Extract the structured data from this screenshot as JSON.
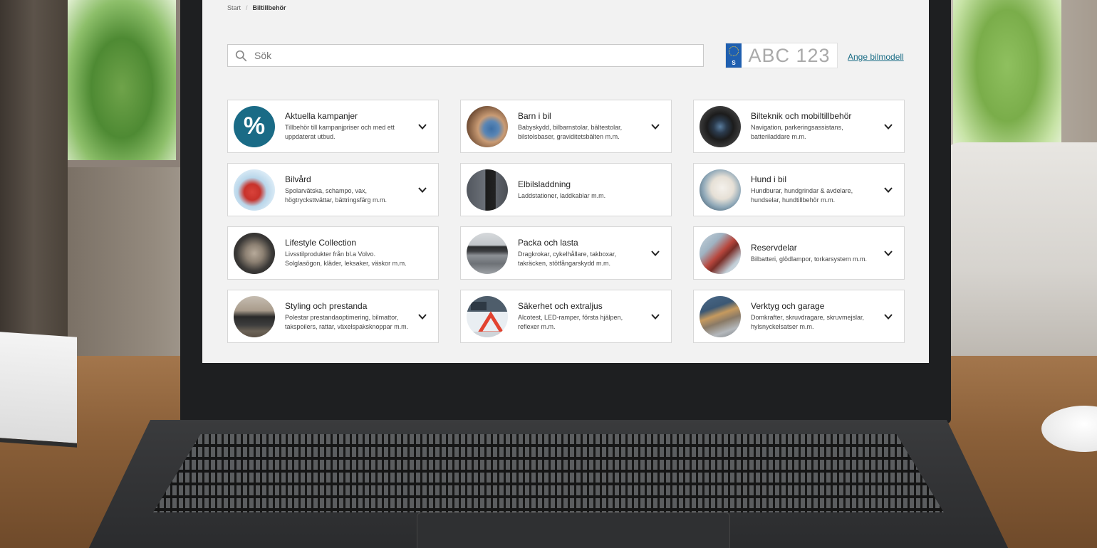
{
  "breadcrumb": {
    "home": "Start",
    "separator": "/",
    "current": "Biltillbehör"
  },
  "search": {
    "placeholder": "Sök"
  },
  "plate": {
    "country": "S",
    "number": "ABC 123"
  },
  "model_link": "Ange bilmodell",
  "categories": [
    {
      "title": "Aktuella kampanjer",
      "desc": "Tillbehör till kampanjpriser och med ett uppdaterat utbud.",
      "icon": "percent-icon",
      "expandable": true
    },
    {
      "title": "Barn i bil",
      "desc": "Babyskydd, bilbarnstolar, bältestolar, bilstolsbaser, graviditetsbälten m.m.",
      "icon": "child-in-car-image",
      "expandable": true
    },
    {
      "title": "Bilteknik och mobiltillbehör",
      "desc": "Navigation, parkeringsassistans, batteriladdare m.m.",
      "icon": "dashboard-screen-image",
      "expandable": true
    },
    {
      "title": "Bilvård",
      "desc": "Spolarvätska, schampo, vax, högtrycksttvättar, bättringsfärg m.m.",
      "icon": "car-care-image",
      "expandable": true
    },
    {
      "title": "Elbilsladdning",
      "desc": "Laddstationer, laddkablar m.m.",
      "icon": "charger-image",
      "expandable": false
    },
    {
      "title": "Hund i bil",
      "desc": "Hundburar, hundgrindar & avdelare, hundselar, hundtillbehör m.m.",
      "icon": "dog-image",
      "expandable": true
    },
    {
      "title": "Lifestyle Collection",
      "desc": "Livsstilprodukter från bl.a Volvo. Solglasögon, kläder, leksaker, väskor m.m.",
      "icon": "lifestyle-image",
      "expandable": false
    },
    {
      "title": "Packa och lasta",
      "desc": "Dragkrokar, cykelhållare, takboxar, takräcken, stötfångarskydd m.m.",
      "icon": "roofbox-car-image",
      "expandable": true
    },
    {
      "title": "Reservdelar",
      "desc": "Bilbatteri, glödlampor, torkarsystem m.m.",
      "icon": "wiper-image",
      "expandable": true
    },
    {
      "title": "Styling och prestanda",
      "desc": "Polestar prestandaoptimering, bilmattor, takspoilers, rattar, växelspaksknoppar m.m.",
      "icon": "suv-image",
      "expandable": true
    },
    {
      "title": "Säkerhet och extraljus",
      "desc": "Alcotest, LED-ramper, första hjälpen, reflexer m.m.",
      "icon": "warning-triangle-image",
      "expandable": true
    },
    {
      "title": "Verktyg och garage",
      "desc": "Domkrafter, skruvdragare, skruvmejslar, hylsnyckelsatser m.m.",
      "icon": "tools-image",
      "expandable": true
    }
  ],
  "colors": {
    "accent": "#1a6b86",
    "link": "#1b6d86",
    "plate_eu": "#1f5fb0"
  }
}
